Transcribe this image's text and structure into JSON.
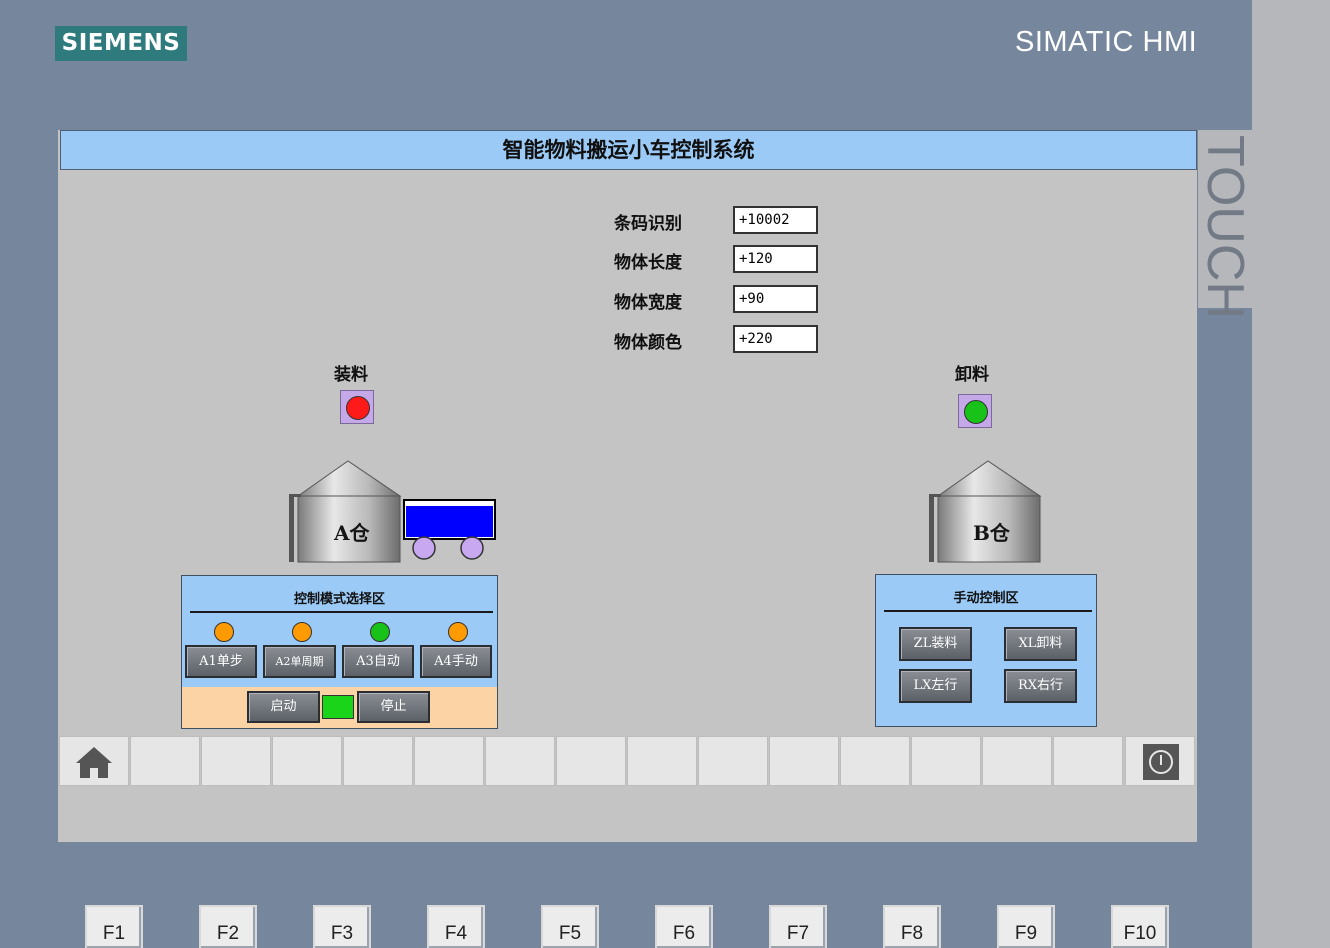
{
  "brand": {
    "logo": "SIEMENS",
    "product": "SIMATIC HMI",
    "touch": "TOUCH"
  },
  "screen_title": "智能物料搬运小车控制系统",
  "fields": [
    {
      "label": "条码识别",
      "value": "+10002"
    },
    {
      "label": "物体长度",
      "value": "+120"
    },
    {
      "label": "物体宽度",
      "value": "+90"
    },
    {
      "label": "物体颜色",
      "value": "+220"
    }
  ],
  "load": {
    "label": "装料",
    "lamp_color": "#ff1a1a"
  },
  "unload": {
    "label": "卸料",
    "lamp_color": "#19c219"
  },
  "silo_a": {
    "label": "A仓"
  },
  "silo_b": {
    "label": "B仓"
  },
  "cart": {
    "body_color": "#0000ff",
    "wheel_color": "#c8a8f0"
  },
  "mode_panel": {
    "title": "控制模式选择区",
    "modes": [
      {
        "label": "A1单步",
        "lamp_color": "#ff9a00"
      },
      {
        "label": "A2单周期",
        "lamp_color": "#ff9a00"
      },
      {
        "label": "A3自动",
        "lamp_color": "#19c219"
      },
      {
        "label": "A4手动",
        "lamp_color": "#ff9a00"
      }
    ],
    "start_label": "启动",
    "stop_label": "停止",
    "run_indicator_color": "#19d419"
  },
  "manual_panel": {
    "title": "手动控制区",
    "buttons": [
      "ZL装料",
      "XL卸料",
      "LX左行",
      "RX右行"
    ]
  },
  "nav_bar": {
    "left_icon": "home-icon",
    "right_icon": "power-icon",
    "empty_keys": 14
  },
  "function_keys": [
    "F1",
    "F2",
    "F3",
    "F4",
    "F5",
    "F6",
    "F7",
    "F8",
    "F9",
    "F10"
  ]
}
